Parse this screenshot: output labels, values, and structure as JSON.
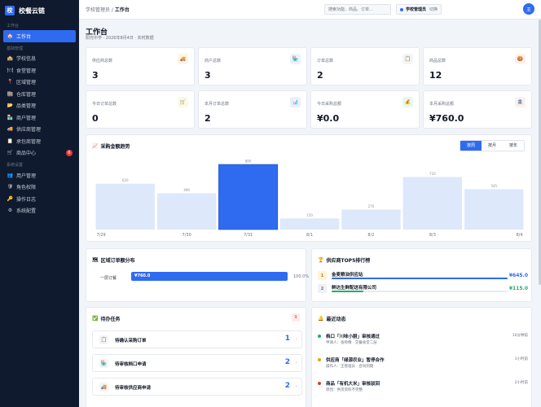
{
  "brand": {
    "logo": "校",
    "name": "校餐云链"
  },
  "sidebar": {
    "sections": [
      {
        "label": "工作台",
        "items": [
          {
            "icon": "🏠",
            "label": "工作台",
            "active": true
          }
        ]
      },
      {
        "label": "基础管理",
        "items": [
          {
            "icon": "🏫",
            "label": "学校信息"
          },
          {
            "icon": "🍽",
            "label": "食堂管理"
          },
          {
            "icon": "📍",
            "label": "区域管理"
          },
          {
            "icon": "🏬",
            "label": "仓库管理"
          },
          {
            "icon": "📂",
            "label": "品类管理"
          },
          {
            "icon": "🏪",
            "label": "商户管理"
          },
          {
            "icon": "🚚",
            "label": "供应商管理"
          },
          {
            "icon": "📋",
            "label": "承包商管理"
          },
          {
            "icon": "🛒",
            "label": "商品中心",
            "badge": "6"
          }
        ]
      },
      {
        "label": "系统设置",
        "items": [
          {
            "icon": "👥",
            "label": "用户管理"
          },
          {
            "icon": "🛡",
            "label": "角色权限"
          },
          {
            "icon": "🔑",
            "label": "操作日志"
          },
          {
            "icon": "⚙",
            "label": "系统配置"
          }
        ]
      }
    ]
  },
  "header": {
    "crumb_parent": "学校管理员",
    "crumb_sep": " / ",
    "crumb_current": "工作台",
    "search_placeholder": "搜索功能、商品、订单...",
    "role": "学校管理员",
    "switch": "切换",
    "avatar": "王"
  },
  "page": {
    "title": "工作台",
    "subtitle": "阳光中学 · 2026年8月4日 · 实时数据"
  },
  "stats": [
    {
      "label": "供应商总数",
      "value": "3",
      "icon": "🚚",
      "icon_bg": "#fff4e0"
    },
    {
      "label": "商户总数",
      "value": "3",
      "icon": "🏪",
      "icon_bg": "#e8f4fd"
    },
    {
      "label": "订单总数",
      "value": "2",
      "icon": "📋",
      "icon_bg": "#f3f4f6"
    },
    {
      "label": "商品总数",
      "value": "12",
      "icon": "🍪",
      "icon_bg": "#fdf0ec"
    },
    {
      "label": "今日订单总数",
      "value": "0",
      "icon": "🛒",
      "icon_bg": "#fff8e1"
    },
    {
      "label": "本月订单总数",
      "value": "2",
      "icon": "📊",
      "icon_bg": "#e8f0fd"
    },
    {
      "label": "今日采购总额",
      "value": "¥0.0",
      "icon": "💰",
      "icon_bg": "#e9f7ef"
    },
    {
      "label": "本月采购总额",
      "value": "¥760.0",
      "icon": "🏦",
      "icon_bg": "#fdf0ec"
    }
  ],
  "trend": {
    "icon": "📈",
    "title": "采购金额趋势",
    "tabs": [
      {
        "label": "按周",
        "active": true
      },
      {
        "label": "按月"
      },
      {
        "label": "按年"
      }
    ]
  },
  "chart_data": {
    "type": "bar",
    "categories": [
      "7/29",
      "7/30",
      "7/31",
      "8/1",
      "8/2",
      "8/3",
      "8/4"
    ],
    "values": [
      620,
      490,
      880,
      150,
      270,
      710,
      545
    ],
    "highlight_index": 2,
    "bar_color": "#dde8fb",
    "highlight_color": "#2f6bf0"
  },
  "distribution": {
    "icon": "🗺",
    "title": "区域订单额分布",
    "rows": [
      {
        "label": "一层订餐",
        "amount": "¥760.0",
        "pct_label": "100.0%",
        "pct": 100
      }
    ]
  },
  "ranking": {
    "icon": "🏆",
    "title": "供应商TOP5排行榜",
    "rows": [
      {
        "rank": "1",
        "name": "金麦粮油供应站",
        "amount": "¥645.0",
        "pct": 100,
        "color": "#2f6bf0",
        "amount_color": "#2f6bf0",
        "rank_bg": "#fff4d6",
        "rank_color": "#b7791f"
      },
      {
        "rank": "2",
        "name": "鲜达生鲜配送有限公司",
        "amount": "¥115.0",
        "pct": 18,
        "color": "#1fae6c",
        "amount_color": "#1fae6c",
        "rank_bg": "#eef1f6",
        "rank_color": "#6b7280"
      }
    ]
  },
  "todo": {
    "icon": "✅",
    "title": "待办任务",
    "count": "9",
    "items": [
      {
        "icon": "📋",
        "label": "待确认采购订单",
        "count": "1"
      },
      {
        "icon": "🏪",
        "label": "待审核档口申请",
        "count": "2"
      },
      {
        "icon": "🚚",
        "label": "待审核供应商申请",
        "count": "2"
      }
    ]
  },
  "activity": {
    "icon": "🔔",
    "title": "最近动态",
    "items": [
      {
        "title": "档口「川味小厨」审核通过",
        "sub": "申请人：张师傅 · 交餐食堂二层",
        "time": "10分钟前",
        "color": "#1fae6c"
      },
      {
        "title": "供应商「绿源农业」暂停合作",
        "sub": "操作人：王管理员 · 合同到期",
        "time": "1小时前",
        "color": "#f59e0b"
      },
      {
        "title": "商品「有机大米」审核驳回",
        "sub": "原因：供货资料不完整",
        "time": "2小时前",
        "color": "#e53935"
      }
    ]
  }
}
